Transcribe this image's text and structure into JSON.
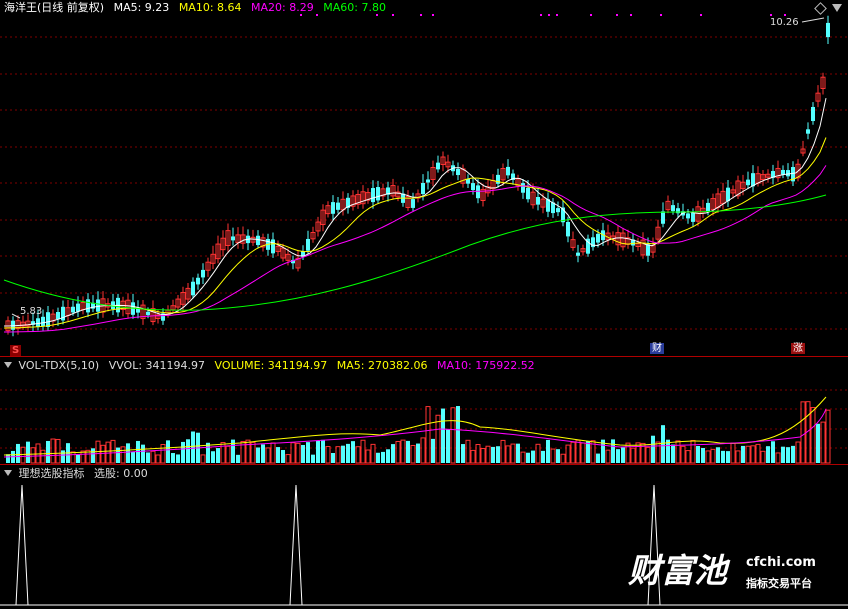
{
  "header": {
    "title": "海洋王(日线 前复权)",
    "ma_labels": [
      {
        "text": "MA5: 9.23",
        "color": "#ffffff"
      },
      {
        "text": "MA10: 8.64",
        "color": "#ffff00"
      },
      {
        "text": "MA20: 8.29",
        "color": "#ff00ff"
      },
      {
        "text": "MA60: 7.80",
        "color": "#00ff00"
      }
    ]
  },
  "price_panel": {
    "high_label": "10.26",
    "low_label": "5.83",
    "events": {
      "s": "S",
      "cai": "财",
      "zhang": "涨"
    }
  },
  "volume_panel": {
    "name": "VOL-TDX(5,10)",
    "vvol": "VVOL: 341194.97",
    "volume": "VOLUME: 341194.97",
    "ma5": "MA5: 270382.06",
    "ma10": "MA10: 175922.52"
  },
  "indicator_panel": {
    "name": "理想选股指标",
    "value": "选股: 0.00"
  },
  "watermark": {
    "brand": "财富池",
    "domain": "cfchi.com",
    "tagline": "指标交易平台"
  },
  "colors": {
    "up": "#ff3333",
    "down": "#54ffff",
    "ma5": "#ffffff",
    "ma10": "#ffff00",
    "ma20": "#ff00ff",
    "ma60": "#00ff00",
    "grid": "#800000"
  }
}
